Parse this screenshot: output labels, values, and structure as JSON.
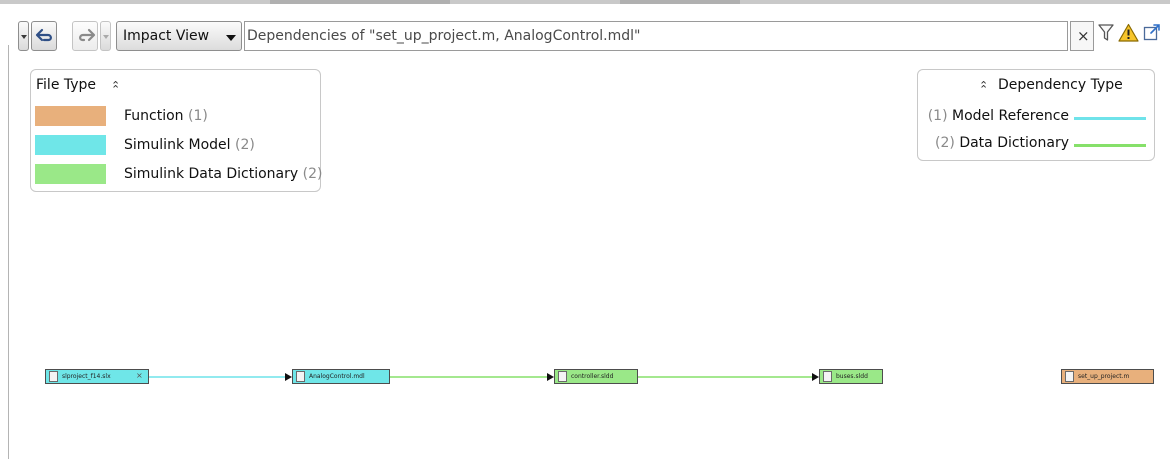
{
  "toolbar": {
    "view_selector": {
      "label": "Impact View"
    },
    "search": {
      "value": "Dependencies of \"set_up_project.m, AnalogControl.mdl\""
    },
    "clear_label": "×",
    "icons": [
      "back-arrow-icon",
      "forward-arrow-icon",
      "filter-icon",
      "warning-icon",
      "open-external-icon"
    ]
  },
  "file_type_legend": {
    "title": "File Type",
    "items": [
      {
        "label": "Function",
        "count": "(1)",
        "color": "#e8b07c"
      },
      {
        "label": "Simulink Model",
        "count": "(2)",
        "color": "#6fe6e8"
      },
      {
        "label": "Simulink Data Dictionary",
        "count": "(2)",
        "color": "#9ae888"
      }
    ]
  },
  "dependency_legend": {
    "title": "Dependency Type",
    "items": [
      {
        "label": "Model Reference",
        "count": "(1)",
        "color": "#6fe3ea"
      },
      {
        "label": "Data Dictionary",
        "count": "(2)",
        "color": "#86e06a"
      }
    ]
  },
  "graph": {
    "nodes": [
      {
        "id": "n1",
        "label": "slproject_f14.slx",
        "type": "Simulink Model",
        "color": "#6fe6e8",
        "has_close": true
      },
      {
        "id": "n2",
        "label": "AnalogControl.mdl",
        "type": "Simulink Model",
        "color": "#6fe6e8"
      },
      {
        "id": "n3",
        "label": "controller.sldd",
        "type": "Simulink Data Dictionary",
        "color": "#9ae888"
      },
      {
        "id": "n4",
        "label": "buses.sldd",
        "type": "Simulink Data Dictionary",
        "color": "#9ae888"
      },
      {
        "id": "n5",
        "label": "set_up_project.m",
        "type": "Function",
        "color": "#e8b07c"
      }
    ],
    "edges": [
      {
        "from": "n1",
        "to": "n2",
        "type": "Model Reference",
        "color": "#6fe3ea"
      },
      {
        "from": "n2",
        "to": "n3",
        "type": "Data Dictionary",
        "color": "#86e06a"
      },
      {
        "from": "n3",
        "to": "n4",
        "type": "Data Dictionary",
        "color": "#86e06a"
      }
    ]
  }
}
